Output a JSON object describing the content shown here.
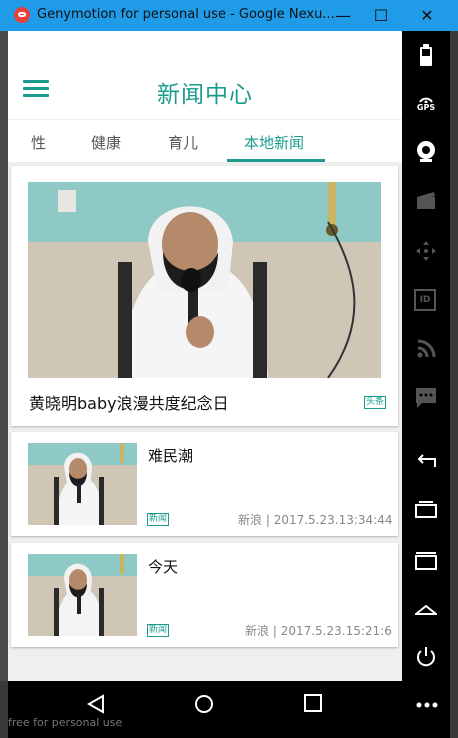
{
  "window": {
    "title": "Genymotion for personal use - Google Nexu...",
    "minimize": "—",
    "maximize": "☐",
    "close": "✕"
  },
  "app": {
    "title": "新闻中心"
  },
  "tabs": [
    {
      "label": "性"
    },
    {
      "label": "健康"
    },
    {
      "label": "育儿"
    },
    {
      "label": "本地新闻"
    }
  ],
  "active_tab": "本地新闻",
  "news": [
    {
      "title": "黄晓明baby浪漫共度纪念日",
      "tag": "头条"
    },
    {
      "title": "难民潮",
      "tag": "新闻",
      "source": "新浪",
      "time": "2017.5.23.13:34:44"
    },
    {
      "title": "今天",
      "tag": "新闻",
      "source": "新浪",
      "time": "2017.5.23.15:21:6"
    }
  ],
  "sidebar": {
    "gps_label": "GPS",
    "id_label": "ID"
  },
  "footer_text": "free for personal use",
  "colors": {
    "accent": "#1a9b8d",
    "titlebar": "#1f9be8"
  }
}
